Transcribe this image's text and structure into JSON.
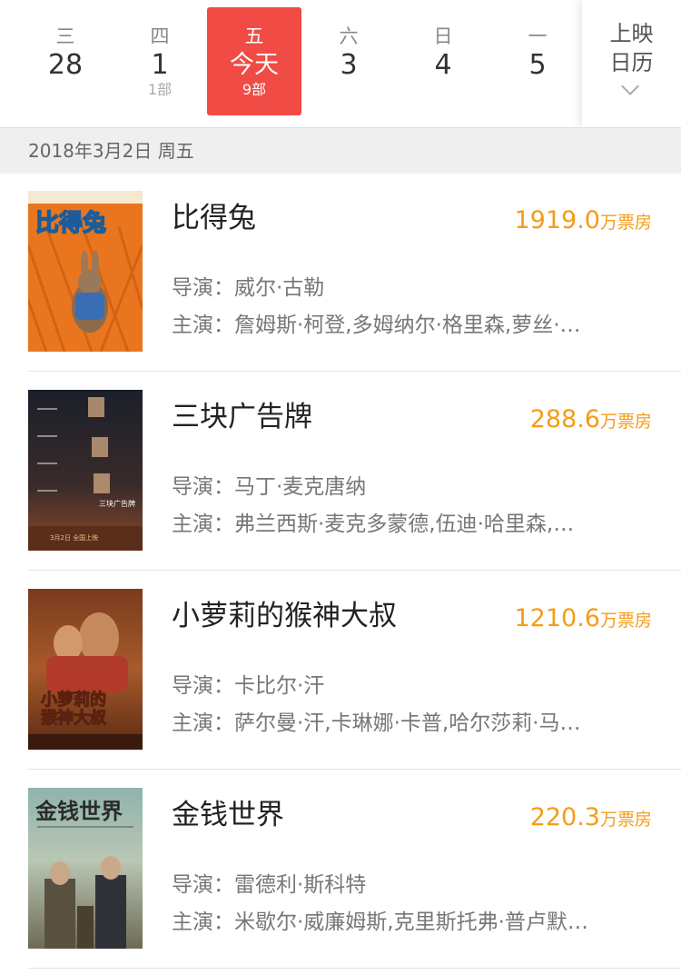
{
  "date_strip": {
    "days": [
      {
        "weekday": "三",
        "day": "28",
        "count": ""
      },
      {
        "weekday": "四",
        "day": "1",
        "count": "1部"
      },
      {
        "weekday": "五",
        "day": "今天",
        "count": "9部"
      },
      {
        "weekday": "六",
        "day": "3",
        "count": ""
      },
      {
        "weekday": "日",
        "day": "4",
        "count": ""
      },
      {
        "weekday": "一",
        "day": "5",
        "count": ""
      }
    ],
    "active_index": 2,
    "calendar_button": {
      "line1": "上映",
      "line2": "日历"
    }
  },
  "date_header": "2018年3月2日 周五",
  "colors": {
    "accent": "#f04b44",
    "gross": "#f49c17"
  },
  "movies": [
    {
      "title": "比得兔",
      "gross_value": "1919.0",
      "gross_unit": "万票房",
      "director_label": "导演：",
      "director": "威尔·古勒",
      "cast_label": "主演：",
      "cast": "詹姆斯·柯登,多姆纳尔·格里森,萝丝·…",
      "poster_icon": "peter-rabbit-poster"
    },
    {
      "title": "三块广告牌",
      "gross_value": "288.6",
      "gross_unit": "万票房",
      "director_label": "导演：",
      "director": "马丁·麦克唐纳",
      "cast_label": "主演：",
      "cast": "弗兰西斯·麦克多蒙德,伍迪·哈里森,…",
      "poster_icon": "three-billboards-poster"
    },
    {
      "title": "小萝莉的猴神大叔",
      "gross_value": "1210.6",
      "gross_unit": "万票房",
      "director_label": "导演：",
      "director": "卡比尔·汗",
      "cast_label": "主演：",
      "cast": "萨尔曼·汗,卡琳娜·卡普,哈尔莎莉·马…",
      "poster_icon": "bajrangi-bhaijaan-poster"
    },
    {
      "title": "金钱世界",
      "gross_value": "220.3",
      "gross_unit": "万票房",
      "director_label": "导演：",
      "director": "雷德利·斯科特",
      "cast_label": "主演：",
      "cast": "米歇尔·威廉姆斯,克里斯托弗·普卢默…",
      "poster_icon": "all-the-money-poster"
    }
  ]
}
